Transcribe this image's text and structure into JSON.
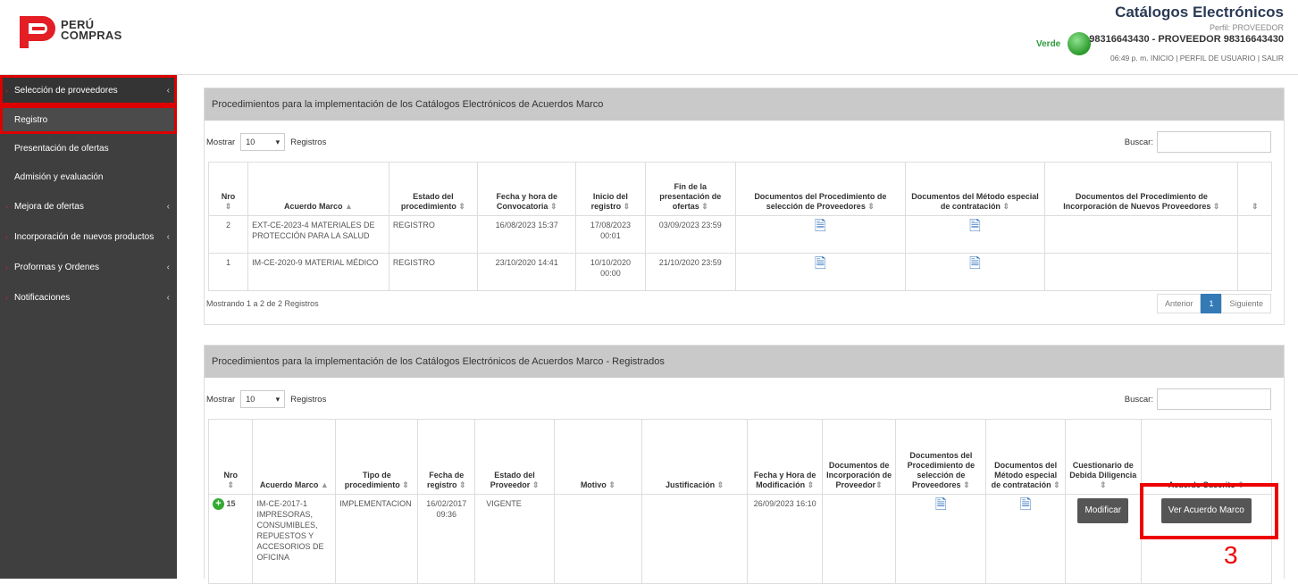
{
  "header": {
    "logo_line1": "PERÚ",
    "logo_line2": "COMPRAS",
    "title": "Catálogos Electrónicos",
    "perfil": "Perfil: PROVEEDOR",
    "status_label": "Verde",
    "user": "98316643430 - PROVEEDOR 98316643430",
    "links": "06:49 p. m. INICIO | PERFIL DE USUARIO | SALIR"
  },
  "sidebar": {
    "group1": "Selección de proveedores",
    "sub1": "Registro",
    "sub2": "Presentación de ofertas",
    "sub3": "Admisión y evaluación",
    "group2": "Mejora de ofertas",
    "group3": "Incorporación de nuevos productos",
    "group4": "Proformas y Ordenes",
    "group5": "Notificaciones"
  },
  "panel1": {
    "title": "Procedimientos para la implementación de los Catálogos Electrónicos de Acuerdos Marco",
    "mostrar": "Mostrar",
    "page_size": "10",
    "registros": "Registros",
    "buscar": "Buscar:",
    "headers": [
      "Nro",
      "Acuerdo Marco",
      "Estado del procedimiento",
      "Fecha y hora de Convocatoria",
      "Inicio del registro",
      "Fin de la presentación de ofertas",
      "Documentos del Procedimiento de selección de Proveedores",
      "Documentos del Método especial de contratación",
      "Documentos del Procedimiento de Incorporación de Nuevos Proveedores",
      ""
    ],
    "rows": [
      {
        "nro": "2",
        "acuerdo": "EXT-CE-2023-4 MATERIALES DE PROTECCIÓN PARA LA SALUD",
        "estado": "REGISTRO",
        "convocatoria": "16/08/2023 15:37",
        "inicio": "17/08/2023 00:01",
        "fin": "03/09/2023 23:59"
      },
      {
        "nro": "1",
        "acuerdo": "IM-CE-2020-9 MATERIAL MÉDICO",
        "estado": "REGISTRO",
        "convocatoria": "23/10/2020 14:41",
        "inicio": "10/10/2020 00:00",
        "fin": "21/10/2020 23:59"
      }
    ],
    "info": "Mostrando 1 a 2 de 2 Registros",
    "prev": "Anterior",
    "page": "1",
    "next": "Siguiente"
  },
  "panel2": {
    "title": "Procedimientos para la implementación de los Catálogos Electrónicos de Acuerdos Marco - Registrados",
    "mostrar": "Mostrar",
    "page_size": "10",
    "registros": "Registros",
    "buscar": "Buscar:",
    "headers": [
      "Nro",
      "Acuerdo Marco",
      "Tipo de procedimiento",
      "Fecha de registro",
      "Estado del Proveedor",
      "Motivo",
      "Justificación",
      "Fecha y Hora de Modificación",
      "Documentos de Incorporación de Proveedor",
      "Documentos del Procedimiento de selección de Proveedores",
      "Documentos del Método especial de contratación",
      "Cuestionario de Debida Diligencia",
      "Acuerdo Suscrito"
    ],
    "row": {
      "nro": "15",
      "acuerdo": "IM-CE-2017-1 IMPRESORAS, CONSUMIBLES, REPUESTOS Y ACCESORIOS DE OFICINA",
      "tipo": "IMPLEMENTACION",
      "fecha": "16/02/2017 09:36",
      "estado": "VIGENTE",
      "modificacion": "26/09/2023 16:10",
      "btn_modificar": "Modificar",
      "btn_ver": "Ver Acuerdo Marco"
    }
  },
  "annotation": {
    "step": "3"
  }
}
